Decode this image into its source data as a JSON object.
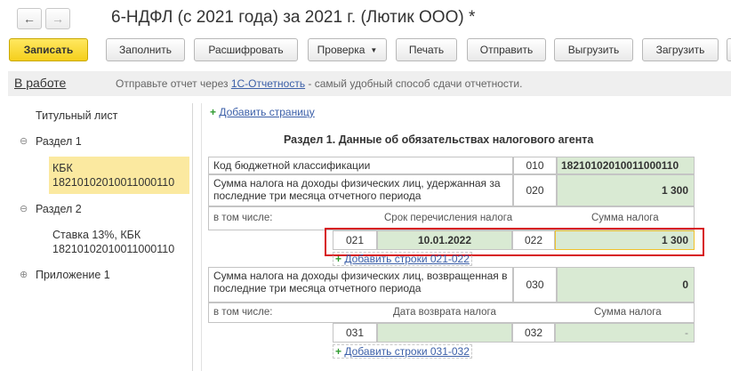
{
  "window": {
    "title": "6-НДФЛ (с 2021 года) за 2021 г. (Лютик ООО) *",
    "back_icon": "arrow-left-icon",
    "forward_icon": "arrow-right-icon"
  },
  "toolbar": {
    "save": "Записать",
    "fill": "Заполнить",
    "decode": "Расшифровать",
    "check": "Проверка",
    "print": "Печать",
    "send": "Отправить",
    "upload": "Выгрузить",
    "load": "Загрузить"
  },
  "status": {
    "state": "В работе",
    "text_before": "Отправьте отчет через ",
    "link": "1С-Отчетность",
    "text_after": " - самый удобный способ сдачи отчетности."
  },
  "sidebar": {
    "title_page": "Титульный лист",
    "section1": "Раздел 1",
    "kbk_label": "КБК",
    "kbk_value": "18210102010011000110",
    "section2": "Раздел 2",
    "rate_label": "Ставка 13%, КБК",
    "rate_value": "18210102010011000110",
    "appendix1": "Приложение 1",
    "expanded_marker": "⊖",
    "collapsed_marker": "⊕"
  },
  "content": {
    "add_page": "Добавить страницу",
    "heading": "Раздел 1. Данные об обязательствах налогового агента",
    "kbk_row": {
      "label": "Код бюджетной классификации",
      "code": "010",
      "value": "18210102010011000110"
    },
    "withheld_row": {
      "label": "Сумма налога на доходы физических лиц, удержанная за последние три месяца отчетного периода",
      "code": "020",
      "value": "1 300"
    },
    "withheld_sub": {
      "including": "в том числе:",
      "date_header": "Срок перечисления налога",
      "sum_header": "Сумма налога",
      "date_code": "021",
      "date_value": "10.01.2022",
      "sum_code": "022",
      "sum_value": "1 300"
    },
    "add_rows_021": "Добавить строки 021-022",
    "returned_row": {
      "label": "Сумма налога на доходы физических лиц, возвращенная в последние три месяца отчетного периода",
      "code": "030",
      "value": "0"
    },
    "returned_sub": {
      "including": "в том числе:",
      "date_header": "Дата возврата налога",
      "sum_header": "Сумма налога",
      "date_code": "031",
      "date_value": "",
      "sum_code": "032",
      "sum_value": "-"
    },
    "add_rows_031": "Добавить строки 031-032"
  }
}
